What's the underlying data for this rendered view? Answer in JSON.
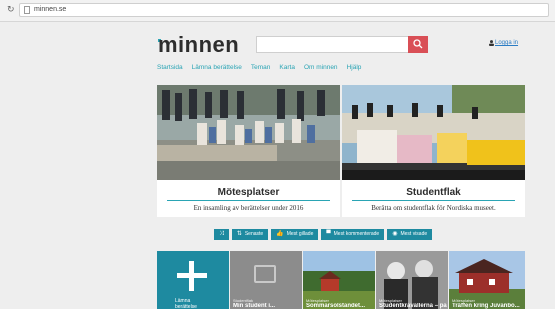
{
  "browser": {
    "url": "minnen.se"
  },
  "header": {
    "logo": "minnen",
    "search_placeholder": "",
    "login_label": "Logga in"
  },
  "nav": {
    "items": [
      "Startsida",
      "Lämna berättelse",
      "Teman",
      "Karta",
      "Om minnen",
      "Hjälp"
    ]
  },
  "featured": [
    {
      "title": "Mötesplatser",
      "subtitle": "En insamling av berättelser under 2016"
    },
    {
      "title": "Studentflak",
      "subtitle": "Berätta om studentflak för Nordiska museet."
    }
  ],
  "filters": [
    "Senaste",
    "Mest gillade",
    "Mest kommenterade",
    "Mest visade"
  ],
  "tiles": [
    {
      "add_label": "Lämna\nberättelse"
    },
    {
      "category": "Studentflak",
      "title": "Min student i..."
    },
    {
      "category": "Mötesplatser",
      "title": "Sommarsolståndet..."
    },
    {
      "category": "Mötesplatser",
      "title": "Studentkravallerna – påkostade..."
    },
    {
      "category": "Mötesplatser",
      "title": "Träffen kring Juvanbo..."
    }
  ],
  "colors": {
    "accent": "#2aa4b4",
    "dark_teal": "#1e8aa0",
    "search_red": "#d94f56"
  }
}
